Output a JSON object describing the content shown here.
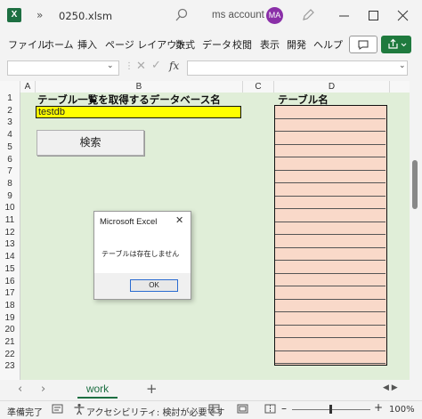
{
  "titlebar": {
    "more_glyph": "»",
    "doc_title": "0250.xlsm",
    "account_name": "ms account",
    "avatar_initials": "MA",
    "excel_logo_letter": "X"
  },
  "ribbon": {
    "menu": [
      "ファイル",
      "ホーム",
      "挿入",
      "ページ レイアウト",
      "数式",
      "データ",
      "校閲",
      "表示",
      "開発",
      "ヘルプ"
    ]
  },
  "formula_bar": {
    "name_box": "",
    "fx_label": "fx",
    "formula": ""
  },
  "grid": {
    "columns": [
      "A",
      "B",
      "C",
      "D"
    ],
    "rows": [
      "1",
      "2",
      "3",
      "4",
      "5",
      "6",
      "7",
      "8",
      "9",
      "10",
      "11",
      "12",
      "13",
      "14",
      "15",
      "16",
      "17",
      "18",
      "19",
      "20",
      "21",
      "22",
      "23"
    ],
    "b1_caption": "テーブル一覧を取得するデータベース名",
    "b2_value": "testdb",
    "d1_caption": "テーブル名",
    "search_button": "検索",
    "table_rows": 20,
    "colors": {
      "sheet_bg": "#e0eed8",
      "input_cell": "#ffff00",
      "table_fill": "#f9d9c9"
    }
  },
  "dialog": {
    "title": "Microsoft Excel",
    "message": "テーブルは存在しません",
    "ok_label": "OK"
  },
  "sheet_tabs": {
    "active": "work",
    "add_label": "+"
  },
  "statusbar": {
    "ready": "準備完了",
    "accessibility": "アクセシビリティ: 検討が必要です",
    "zoom": "100%"
  }
}
